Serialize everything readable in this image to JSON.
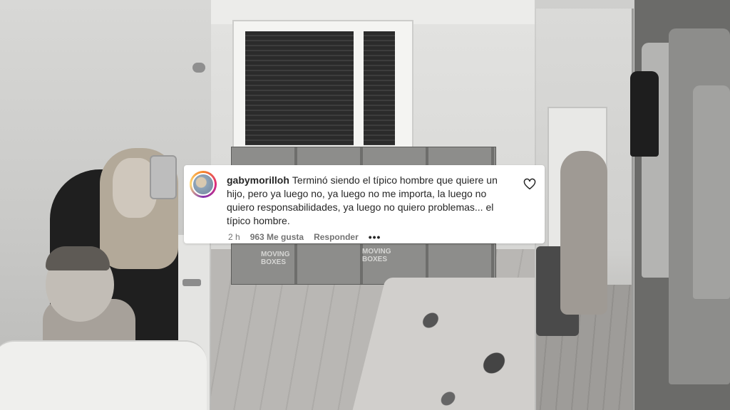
{
  "comment": {
    "username": "gabymorilloh",
    "text": "Terminó siendo el típico hombre que quiere un hijo, pero ya luego no, ya luego no me importa, la luego no quiero responsabilidades, ya luego no quiero problemas... el típico hombre.",
    "time": "2 h",
    "likes": "963 Me gusta",
    "reply_label": "Responder",
    "more_icon": "more-dots-icon",
    "like_icon": "heart-outline-icon"
  },
  "photos": {
    "left": "bathroom-mirror-selfie",
    "middle": "bedroom-with-moving-boxes",
    "right": "closet-mirror-selfie"
  },
  "box_print": {
    "line1": "MOVING",
    "line2": "BOXES"
  }
}
